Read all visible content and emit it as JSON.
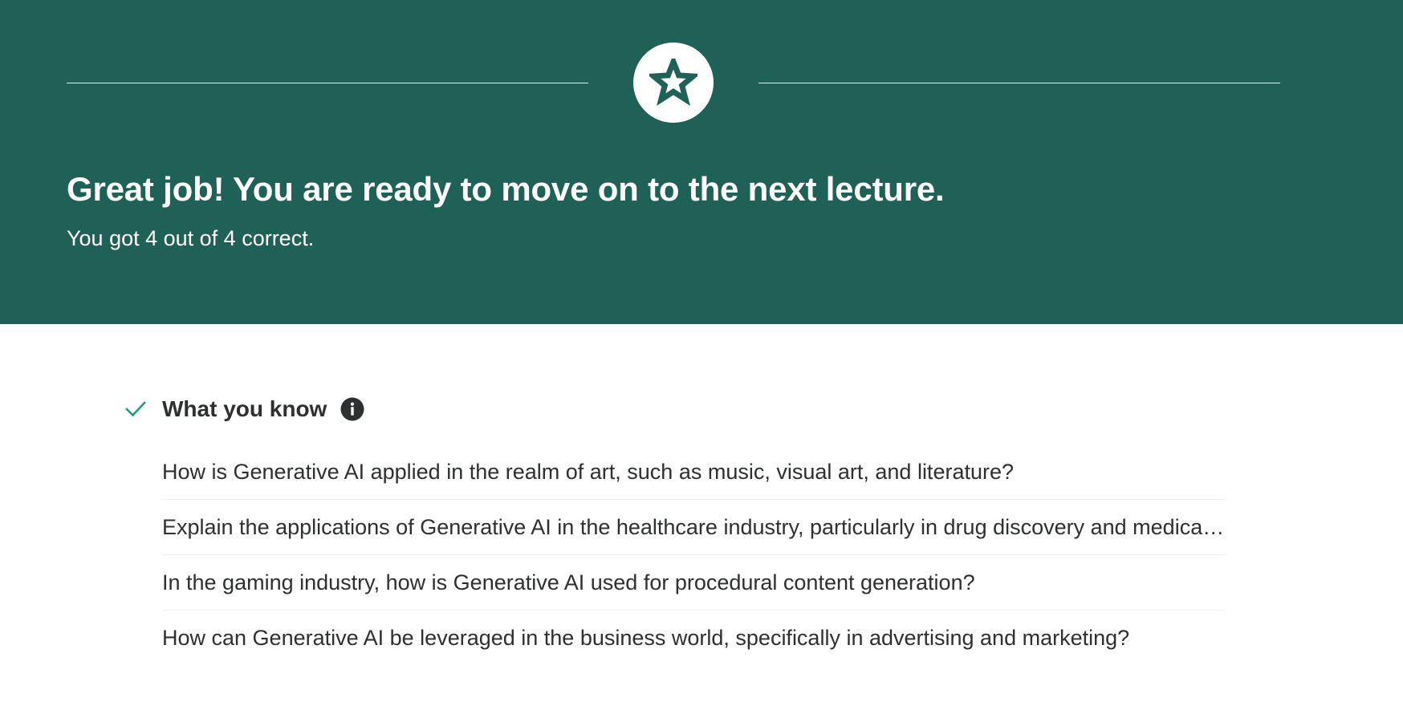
{
  "hero": {
    "icon": "star-icon",
    "title": "Great job! You are ready to move on to the next lecture.",
    "score_text": "You got 4 out of 4 correct.",
    "background_color": "#206157"
  },
  "knowledge": {
    "icon": "check-icon",
    "title": "What you know",
    "info_icon": "info-icon",
    "accent_color": "#1e9c85",
    "questions": [
      "How is Generative AI applied in the realm of art, such as music, visual art, and literature?",
      "Explain the applications of Generative AI in the healthcare industry, particularly in drug discovery and medical imaging.",
      "In the gaming industry, how is Generative AI used for procedural content generation?",
      "How can Generative AI be leveraged in the business world, specifically in advertising and marketing?"
    ]
  }
}
